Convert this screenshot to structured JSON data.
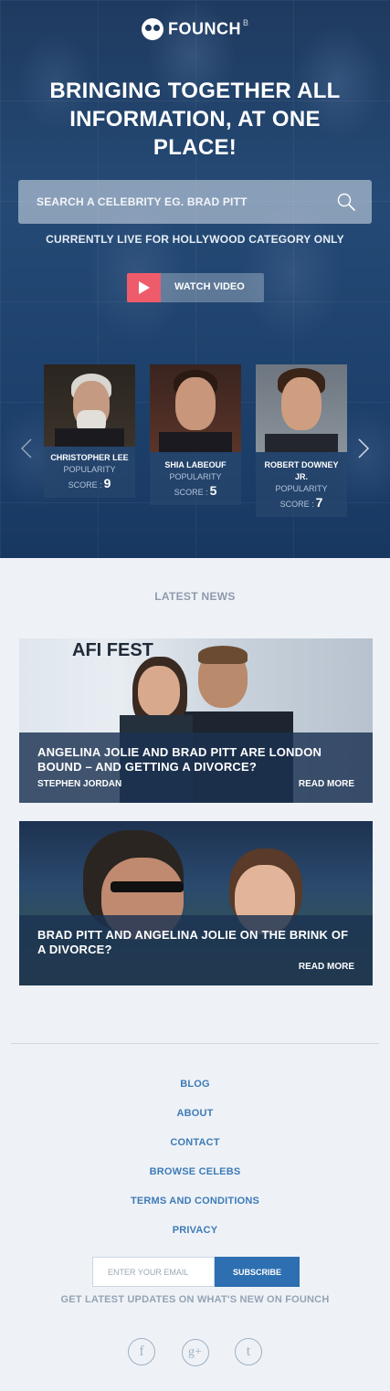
{
  "brand": {
    "name": "FOUNCH",
    "sup": "B"
  },
  "hero": {
    "headline": "BRINGING TOGETHER ALL INFORMATION, AT ONE PLACE!",
    "search_placeholder": "SEARCH A CELEBRITY EG. BRAD PITT",
    "live_note": "CURRENTLY LIVE FOR HOLLYWOOD CATEGORY ONLY",
    "watch_label": "WATCH VIDEO"
  },
  "celebs": [
    {
      "name": "CHRISTOPHER LEE",
      "popularity_label": "POPULARITY",
      "score_label": "SCORE :",
      "score": "9"
    },
    {
      "name": "SHIA LABEOUF",
      "popularity_label": "POPULARITY",
      "score_label": "SCORE :",
      "score": "5"
    },
    {
      "name": "ROBERT DOWNEY JR.",
      "popularity_label": "POPULARITY",
      "score_label": "SCORE :",
      "score": "7"
    }
  ],
  "news": {
    "title": "LATEST NEWS",
    "items": [
      {
        "headline": "ANGELINA JOLIE AND BRAD PITT ARE LONDON BOUND – AND GETTING A DIVORCE?",
        "author": "STEPHEN JORDAN",
        "read_more": "READ MORE",
        "bg_text": "AFI FEST"
      },
      {
        "headline": "BRAD PITT AND ANGELINA JOLIE ON THE BRINK OF A DIVORCE?",
        "author": "",
        "read_more": "READ MORE"
      }
    ]
  },
  "footer": {
    "links": [
      "BLOG",
      "ABOUT",
      "CONTACT",
      "BROWSE CELEBS",
      "TERMS AND CONDITIONS",
      "PRIVACY"
    ],
    "email_placeholder": "ENTER YOUR EMAIL",
    "subscribe_label": "SUBSCRIBE",
    "subscribe_note": "GET LATEST UPDATES ON WHAT'S NEW ON FOUNCH",
    "social": [
      "facebook-icon",
      "google-plus-icon",
      "twitter-icon"
    ],
    "social_glyphs": [
      "f",
      "g+",
      "t"
    ]
  },
  "colors": {
    "hero_bg": "#1f3a5f",
    "accent_red": "#ee5c6c",
    "link_blue": "#3e7bb6",
    "subscribe_blue": "#2d6fb0"
  }
}
